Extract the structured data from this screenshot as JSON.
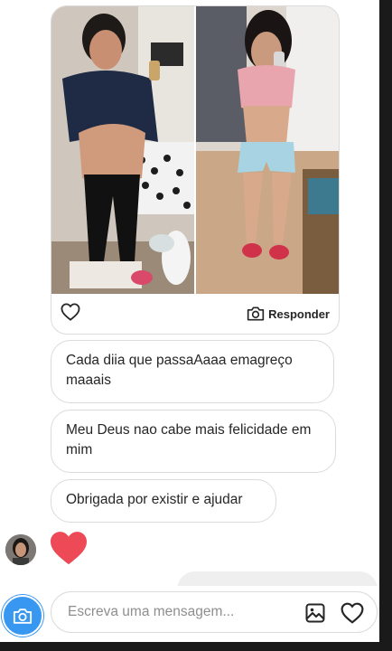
{
  "thread": {
    "photo_post": {
      "left_photo": "before-weight-loss-selfie",
      "right_photo": "after-weight-loss-selfie",
      "reply_label": "Responder",
      "like_icon": "heart-outline-icon",
      "reply_icon": "camera-icon"
    },
    "messages": [
      {
        "text": "Cada diia que passaAaaa emagreço maaais"
      },
      {
        "text": "Meu Deus  nao cabe mais felicidade em mim"
      },
      {
        "text": "Obrigada por existir e ajudar"
      }
    ],
    "reaction": {
      "icon": "heart-icon",
      "color": "#ed4956"
    }
  },
  "composer": {
    "placeholder": "Escreva uma mensagem...",
    "camera_icon": "camera-icon",
    "gallery_icon": "image-icon",
    "like_icon": "heart-outline-icon",
    "accent": "#3897f0"
  }
}
